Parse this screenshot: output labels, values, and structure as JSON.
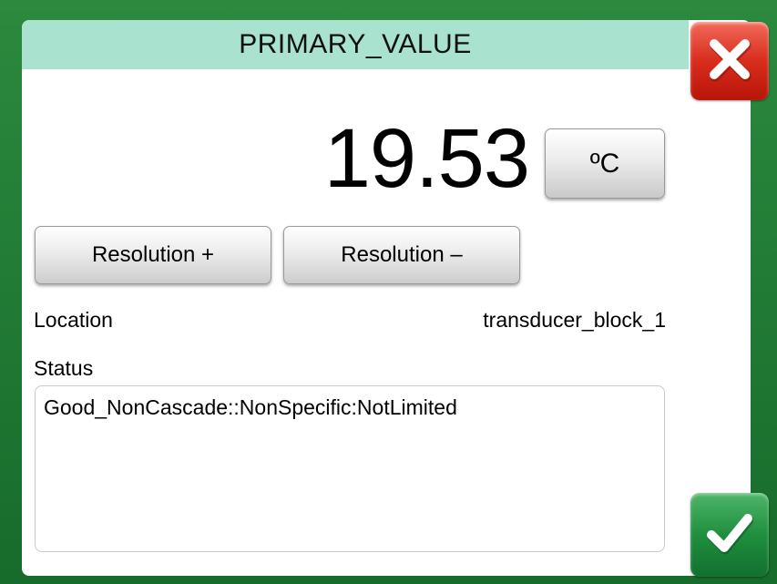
{
  "dialog": {
    "title": "PRIMARY_VALUE",
    "close_icon": "x-icon",
    "ok_icon": "checkmark-icon"
  },
  "measurement": {
    "value": "19.53",
    "unit": "ºC"
  },
  "buttons": {
    "resolution_plus": "Resolution +",
    "resolution_minus": "Resolution –"
  },
  "location": {
    "label": "Location",
    "value": "transducer_block_1"
  },
  "status": {
    "label": "Status",
    "value": "Good_NonCascade::NonSpecific:NotLimited"
  },
  "colors": {
    "frame": "#1f7a34",
    "title_bar": "#a9e3cf",
    "close_button": "#d82d1d",
    "ok_button": "#1f8f3e"
  }
}
